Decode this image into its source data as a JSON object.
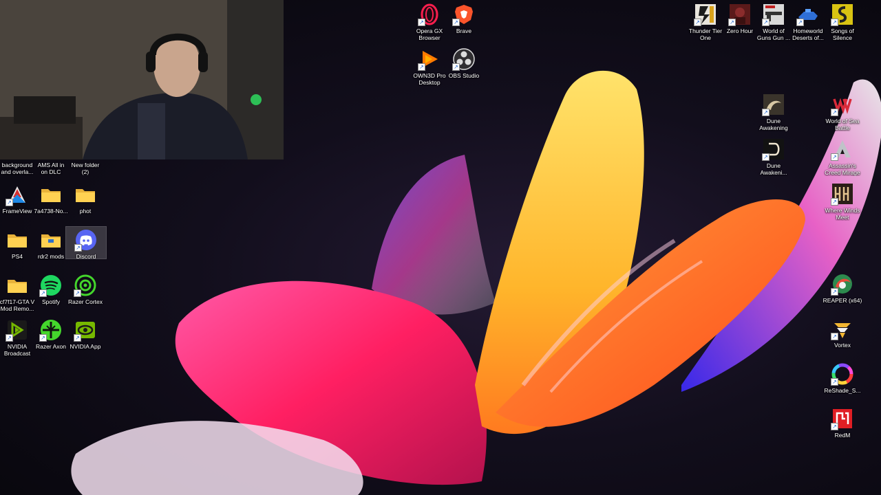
{
  "desktop": {
    "left_column_icons": [
      {
        "id": "background",
        "label": "background\nand overla...",
        "icon": "file-icon"
      },
      {
        "id": "ams",
        "label": "AMS All in\non DLC",
        "icon": "file-icon"
      },
      {
        "id": "new-folder",
        "label": "New folder\n(2)",
        "icon": "folder-icon"
      },
      {
        "id": "frameview",
        "label": "FrameView",
        "icon": "frameview-icon"
      },
      {
        "id": "7a4738",
        "label": "7a4738-No...",
        "icon": "folder-icon"
      },
      {
        "id": "phot",
        "label": "phot",
        "icon": "folder-icon"
      },
      {
        "id": "ps4",
        "label": "PS4",
        "icon": "folder-icon"
      },
      {
        "id": "rdr2",
        "label": "rdr2 mods",
        "icon": "folder-icon"
      },
      {
        "id": "discord",
        "label": "Discord",
        "icon": "discord-icon"
      },
      {
        "id": "cf7f17",
        "label": "cf7f17-GTA V\nMod Remo...",
        "icon": "folder-icon"
      },
      {
        "id": "spotify",
        "label": "Spotify",
        "icon": "spotify-icon"
      },
      {
        "id": "razer-cortex",
        "label": "Razer Cortex",
        "icon": "razer-cortex-icon"
      },
      {
        "id": "nvidia-broadcast",
        "label": "NVIDIA\nBroadcast",
        "icon": "nvidia-broadcast-icon"
      },
      {
        "id": "razer-axon",
        "label": "Razer Axon",
        "icon": "razer-axon-icon"
      },
      {
        "id": "nvidia-app",
        "label": "NVIDIA App",
        "icon": "nvidia-app-icon"
      }
    ],
    "top_center_icons": [
      {
        "id": "opera-gx",
        "label": "Opera GX\nBrowser",
        "icon": "opera-gx-icon"
      },
      {
        "id": "brave",
        "label": "Brave",
        "icon": "brave-icon"
      },
      {
        "id": "own3d",
        "label": "OWN3D Pro\nDesktop",
        "icon": "own3d-icon"
      },
      {
        "id": "obs",
        "label": "OBS Studio",
        "icon": "obs-icon"
      }
    ],
    "top_right_icons": [
      {
        "id": "thunder-tier-one",
        "label": "Thunder Tier\nOne",
        "icon": "game-icon"
      },
      {
        "id": "zero-hour",
        "label": "Zero Hour",
        "icon": "game-icon"
      },
      {
        "id": "world-of-guns",
        "label": "World of\nGuns Gun ...",
        "icon": "game-icon"
      },
      {
        "id": "homeworld",
        "label": "Homeworld\nDeserts of...",
        "icon": "game-icon"
      },
      {
        "id": "songs-of-silence",
        "label": "Songs of\nSilence",
        "icon": "game-icon"
      }
    ],
    "right_icons": [
      {
        "id": "dune-awakening",
        "label": "Dune\nAwakening",
        "icon": "dune-icon"
      },
      {
        "id": "world-of-sea-battle",
        "label": "World of Sea\nBattle",
        "icon": "game-icon"
      },
      {
        "id": "dune-awakening-2",
        "label": "Dune\nAwakeni...",
        "icon": "dune-icon"
      },
      {
        "id": "assassins-creed",
        "label": "Assassin's\nCreed Mirage",
        "icon": "game-icon"
      },
      {
        "id": "where-winds-meet",
        "label": "Where Winds\nMeet",
        "icon": "game-icon"
      },
      {
        "id": "reaper",
        "label": "REAPER (x64)",
        "icon": "reaper-icon"
      },
      {
        "id": "vortex",
        "label": "Vortex",
        "icon": "vortex-icon"
      },
      {
        "id": "reshade",
        "label": "ReShade_S...",
        "icon": "reshade-icon"
      },
      {
        "id": "redm",
        "label": "RedM",
        "icon": "redm-icon"
      }
    ],
    "selected_icon": "discord"
  }
}
